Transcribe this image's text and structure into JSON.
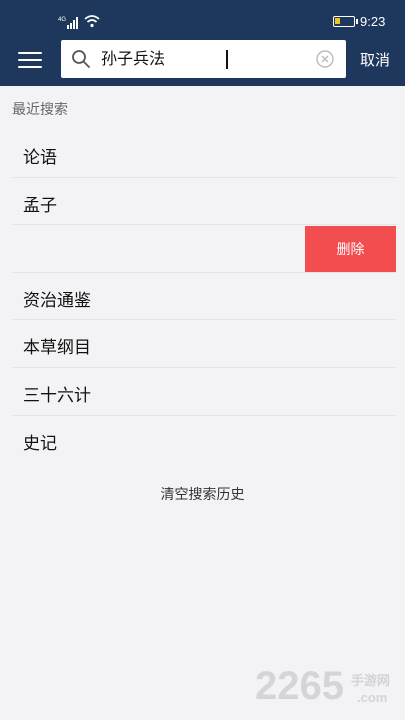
{
  "status_bar": {
    "network": "4G",
    "time": "9:23"
  },
  "header": {
    "search": {
      "value": "孙子兵法",
      "icon": "search-icon"
    },
    "cancel_label": "取消"
  },
  "recent": {
    "title": "最近搜索",
    "items": [
      {
        "label": "论语"
      },
      {
        "label": "孟子"
      },
      {
        "label": ""
      },
      {
        "label": "资治通鉴"
      },
      {
        "label": "本草纲目"
      },
      {
        "label": "三十六计"
      },
      {
        "label": "史记"
      }
    ],
    "delete_label": "删除"
  },
  "clear_history_label": "清空搜索历史",
  "watermark": {
    "number": "2265",
    "site_cn": "手游网",
    "site_domain": ".com"
  },
  "colors": {
    "header_bg": "#1e375c",
    "delete_bg": "#f24d4f",
    "page_bg": "#f3f3f5"
  }
}
